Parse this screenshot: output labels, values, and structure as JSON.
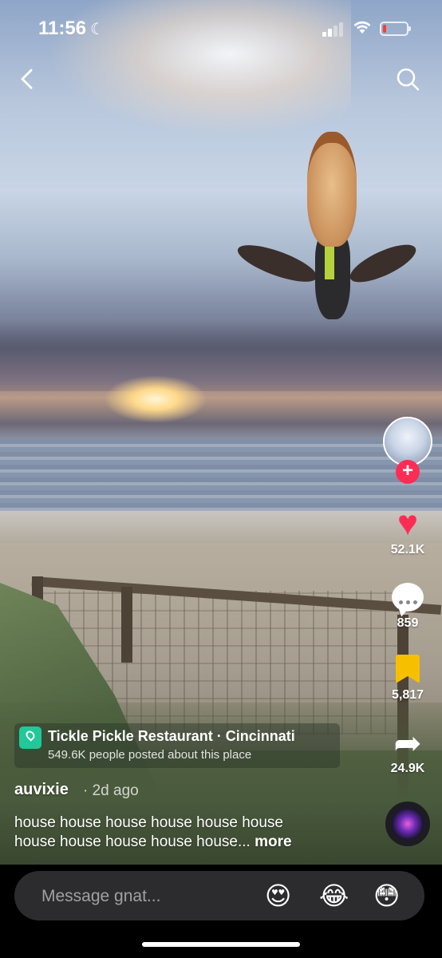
{
  "status_bar": {
    "time": "11:56",
    "moon": "☾",
    "wifi": "◉"
  },
  "nav": {
    "back": "‹"
  },
  "actions": {
    "follow": "+",
    "likes": "52.1K",
    "comments": "859",
    "saves": "5,817",
    "shares": "24.9K",
    "heart_glyph": "♥",
    "share_glyph": "➦"
  },
  "location": {
    "title": "Tickle Pickle Restaurant · Cincinnati",
    "subtitle": "549.6K people posted about this place"
  },
  "post": {
    "username": "auvixie",
    "ago": "· 2d ago",
    "caption_line1": "house house house house house house",
    "caption_line2": "house house house house house...",
    "more": " more"
  },
  "message": {
    "placeholder": "Message gnat...",
    "emojis": [
      "😍",
      "😂",
      "😳"
    ]
  },
  "colors": {
    "accent": "#fe2c55",
    "bookmark": "#f6c000",
    "location_icon": "#20c997"
  }
}
